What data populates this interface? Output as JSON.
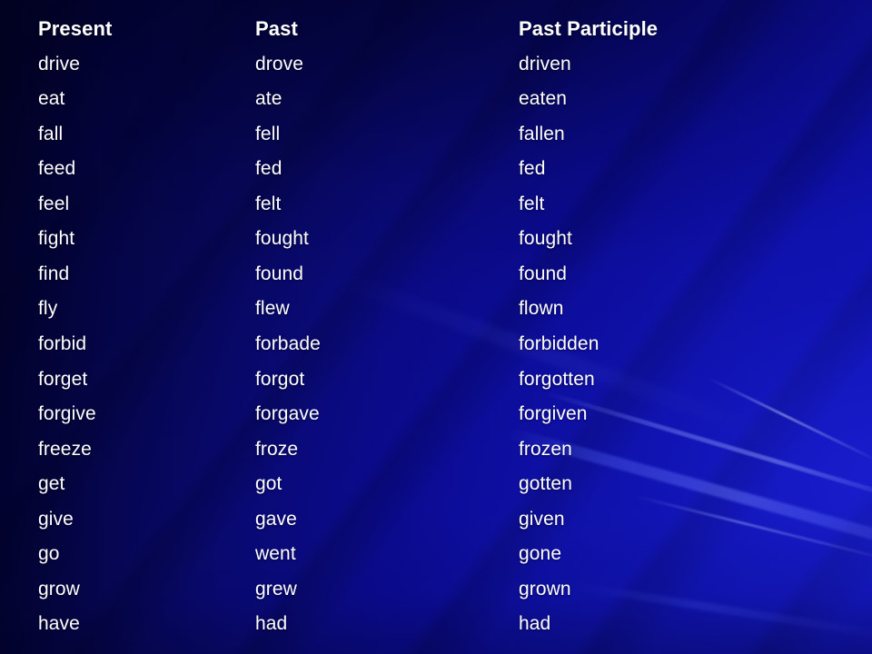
{
  "slide": {
    "background": {
      "base_color_dark": "#04044a",
      "base_color_bright": "#0e12b0",
      "text_color": "#ffffff"
    }
  },
  "table": {
    "columns": [
      "Present",
      "Past",
      "Past Participle"
    ],
    "rows": [
      [
        "drive",
        "drove",
        "driven"
      ],
      [
        "eat",
        "ate",
        "eaten"
      ],
      [
        "fall",
        "fell",
        "fallen"
      ],
      [
        "feed",
        "fed",
        "fed"
      ],
      [
        "feel",
        "felt",
        "felt"
      ],
      [
        "fight",
        "fought",
        "fought"
      ],
      [
        "find",
        "found",
        "found"
      ],
      [
        "fly",
        "flew",
        "flown"
      ],
      [
        "forbid",
        "forbade",
        "forbidden"
      ],
      [
        "forget",
        "forgot",
        "forgotten"
      ],
      [
        "forgive",
        "forgave",
        "forgiven"
      ],
      [
        "freeze",
        "froze",
        "frozen"
      ],
      [
        "get",
        "got",
        "gotten"
      ],
      [
        "give",
        "gave",
        "given"
      ],
      [
        "go",
        "went",
        "gone"
      ],
      [
        "grow",
        "grew",
        "grown"
      ],
      [
        "have",
        "had",
        "had"
      ]
    ]
  }
}
